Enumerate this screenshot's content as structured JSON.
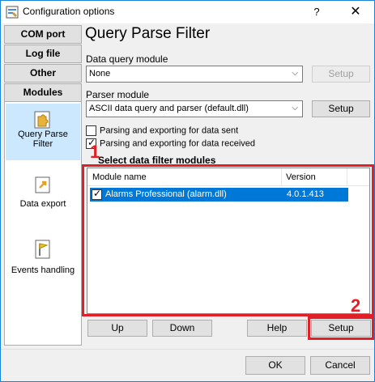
{
  "window": {
    "title": "Configuration options",
    "help_glyph": "?",
    "close_glyph": "✕"
  },
  "nav": {
    "buttons": [
      "COM port",
      "Log file",
      "Other",
      "Modules"
    ],
    "panel_items": [
      {
        "label_line1": "Query Parse",
        "label_line2": "Filter",
        "icon": "puzzle-icon",
        "selected": true
      },
      {
        "label_line1": "Data export",
        "label_line2": "",
        "icon": "export-icon",
        "selected": false
      },
      {
        "label_line1": "Events handling",
        "label_line2": "",
        "icon": "flag-icon",
        "selected": false
      }
    ]
  },
  "main": {
    "title": "Query Parse Filter",
    "data_query_module": {
      "label": "Data query module",
      "value": "None",
      "setup_label": "Setup",
      "setup_enabled": false
    },
    "parser_module": {
      "label": "Parser module",
      "value": "ASCII data query and parser (default.dll)",
      "setup_label": "Setup",
      "setup_enabled": true
    },
    "checkboxes": [
      {
        "label": "Parsing and exporting for data sent",
        "checked": false
      },
      {
        "label": "Parsing and exporting for data received",
        "checked": true
      }
    ],
    "filter_section_title": "Select data filter modules",
    "table": {
      "columns": [
        "Module name",
        "Version"
      ],
      "rows": [
        {
          "name": "Alarms Professional (alarm.dll)",
          "version": "4.0.1.413",
          "checked": true,
          "selected": true
        }
      ]
    },
    "buttons": {
      "up": "Up",
      "down": "Down",
      "help": "Help",
      "setup": "Setup"
    }
  },
  "annotations": {
    "marker_1": "1",
    "marker_2": "2",
    "color": "#e21f26"
  },
  "footer": {
    "ok": "OK",
    "cancel": "Cancel"
  }
}
